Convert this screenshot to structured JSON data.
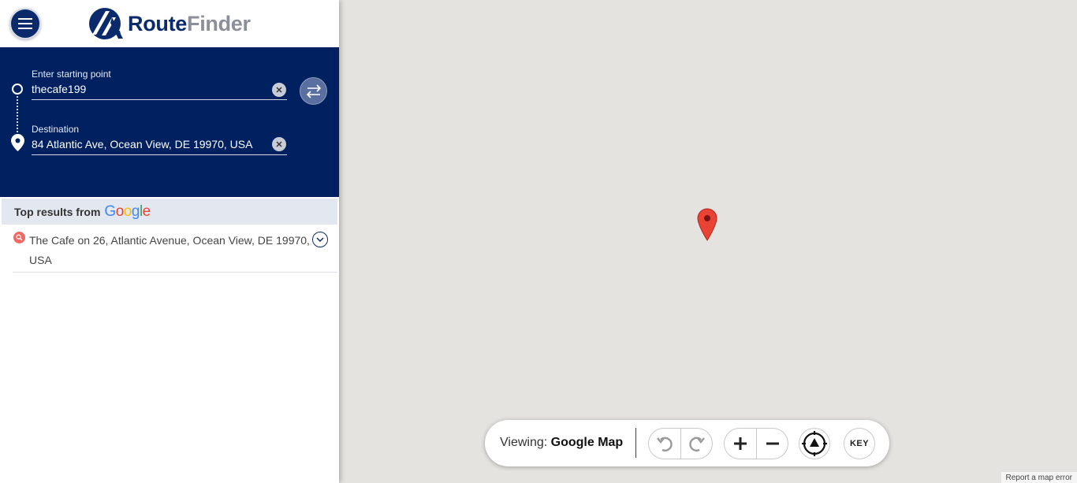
{
  "app": {
    "brand_route": "Route",
    "brand_finder": "Finder"
  },
  "route": {
    "start_label": "Enter starting point",
    "start_value": "thecafe199",
    "dest_label": "Destination",
    "dest_value": "84 Atlantic Ave, Ocean View, DE 19970, USA"
  },
  "results": {
    "header": "Top results from",
    "provider_letters": [
      "G",
      "o",
      "o",
      "g",
      "l",
      "e"
    ],
    "items": [
      {
        "text": "The Cafe on 26, Atlantic Avenue, Ocean View, DE 19970, USA"
      }
    ]
  },
  "controls": {
    "viewing_prefix": "Viewing:",
    "viewing_value": "Google Map",
    "key_label": "KEY"
  },
  "map": {
    "report_link": "Report a map error"
  },
  "colors": {
    "brand_navy": "#00205f",
    "pin_red": "#ea4335",
    "map_bg": "#e5e3df"
  },
  "icons": [
    "menu-icon",
    "swap-icon",
    "clear-icon",
    "location-pin-icon",
    "search-result-icon",
    "chevron-down-icon",
    "undo-icon",
    "redo-icon",
    "zoom-in-icon",
    "zoom-out-icon",
    "locate-icon"
  ]
}
